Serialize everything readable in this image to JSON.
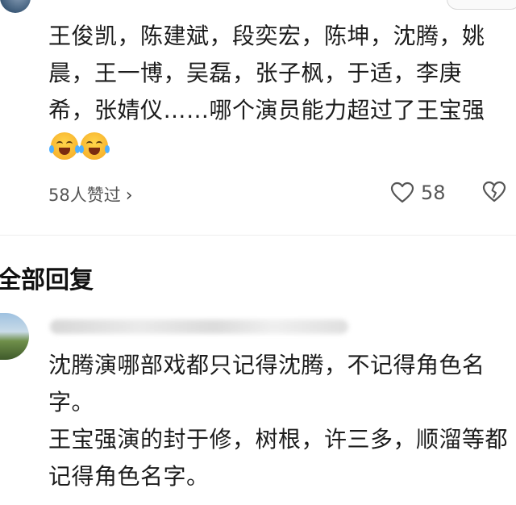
{
  "comment": {
    "text": "王俊凯，陈建斌，段奕宏，陈坤，沈腾，姚晨，王一博，吴磊，张子枫，于适，李庚希，张婧仪……哪个演员能力超过了王宝强",
    "emojis": [
      "crying-laughing-emoji",
      "crying-laughing-emoji"
    ],
    "liked_by_label": "58人赞过",
    "like_count": "58"
  },
  "replies_section": {
    "title": "全部回复"
  },
  "reply": {
    "paragraph_1": "沈腾演哪部戏都只记得沈腾，不记得角色名字。",
    "paragraph_2": "王宝强演的封于修，树根，许三多，顺溜等都记得角色名字。"
  },
  "colors": {
    "text": "#1c1c1c",
    "secondary_text": "#555555",
    "divider": "#eeeeee",
    "emoji_yellow": "#ffd54a"
  },
  "icons": {
    "like": "heart-outline-icon",
    "dislike": "broken-heart-outline-icon",
    "chevron": "chevron-right-icon"
  }
}
